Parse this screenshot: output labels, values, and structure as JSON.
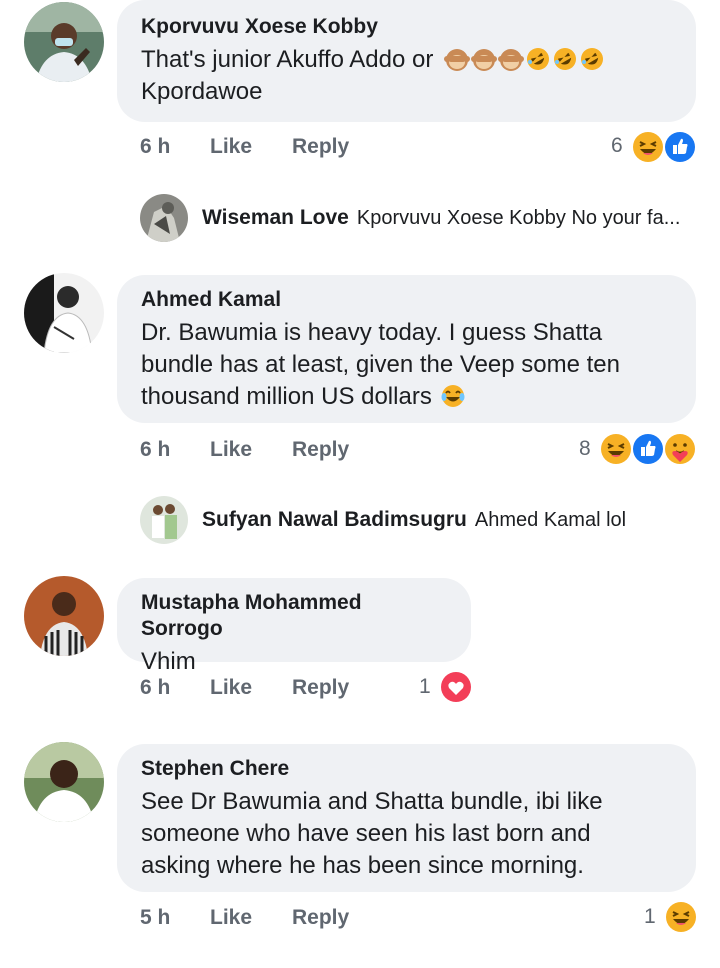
{
  "comments": [
    {
      "author": "Kporvuvu Xoese Kobby",
      "text": "That's junior Akuffo Addo or",
      "text_cont": "Kpordawoe",
      "emojis": [
        "see-no-evil-monkey",
        "see-no-evil-monkey",
        "see-no-evil-monkey",
        "rolling-laughing",
        "rolling-laughing",
        "rolling-laughing"
      ],
      "time": "6 h",
      "like": "Like",
      "reply": "Reply",
      "reaction_count": "6",
      "reactions": [
        "haha",
        "like"
      ]
    },
    {
      "author": "Ahmed Kamal",
      "text_lines": [
        "Dr. Bawumia is heavy today. I guess Shatta",
        "bundle has at least, given the Veep some ten",
        "thousand million US dollars"
      ],
      "emojis": [
        "tears-of-joy"
      ],
      "time": "6 h",
      "like": "Like",
      "reply": "Reply",
      "reaction_count": "8",
      "reactions": [
        "haha",
        "like",
        "care"
      ]
    },
    {
      "author": "Mustapha Mohammed Sorrogo",
      "text": "Vhim",
      "time": "6 h",
      "like": "Like",
      "reply": "Reply",
      "reaction_count": "1",
      "reactions": [
        "love"
      ]
    },
    {
      "author": "Stephen Chere",
      "text_lines": [
        "See Dr Bawumia and Shatta bundle, ibi like",
        "someone who have seen his last born and",
        "asking where he has been since morning."
      ],
      "time": "5 h",
      "like": "Like",
      "reply": "Reply",
      "reaction_count": "1",
      "reactions": [
        "haha"
      ]
    }
  ],
  "replies": [
    {
      "author": "Wiseman Love",
      "text": "Kporvuvu Xoese Kobby No your fa..."
    },
    {
      "author": "Sufyan Nawal Badimsugru",
      "text": "Ahmed Kamal lol"
    }
  ],
  "colors": {
    "bubble": "#eff1f4",
    "meta": "#606770",
    "like_blue": "#1877f2",
    "love_red": "#f33e58",
    "haha_yellow": "#f7b125"
  }
}
